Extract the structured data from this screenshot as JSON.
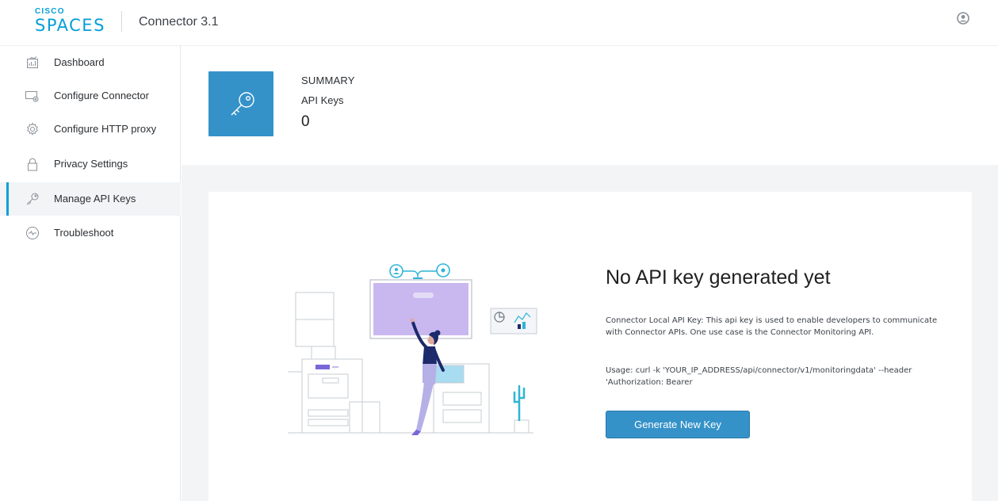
{
  "header": {
    "brand_top": "CISCO",
    "brand_bottom": "SPACES",
    "app_title": "Connector 3.1",
    "user_icon": "user-circle-icon"
  },
  "sidebar": {
    "items": [
      {
        "label": "Dashboard",
        "icon": "dashboard-chart-icon",
        "active": false
      },
      {
        "label": "Configure Connector",
        "icon": "configure-connector-icon",
        "active": false
      },
      {
        "label": "Configure HTTP proxy",
        "icon": "gear-icon",
        "active": false
      },
      {
        "label": "Privacy Settings",
        "icon": "lock-icon",
        "active": false
      },
      {
        "label": "Manage API Keys",
        "icon": "key-icon",
        "active": true
      },
      {
        "label": "Troubleshoot",
        "icon": "pulse-icon",
        "active": false
      }
    ]
  },
  "summary": {
    "heading": "SUMMARY",
    "label": "API Keys",
    "count": "0",
    "tile_icon": "key-icon"
  },
  "empty_state": {
    "title": "No API key generated yet",
    "description": "Connector Local API Key: This api key is used to enable developers to communicate with Connector APIs. One use case is the Connector Monitoring API.",
    "usage": "Usage: curl -k 'YOUR_IP_ADDRESS/api/connector/v1/monitoringdata' --header 'Authorization: Bearer",
    "button_label": "Generate New Key",
    "illustration": "person-at-screen-illustration"
  },
  "colors": {
    "brand": "#049fd9",
    "accent": "#3592c9",
    "illustration_purple": "#c9b8f0",
    "illustration_navy": "#1d2a6b"
  }
}
